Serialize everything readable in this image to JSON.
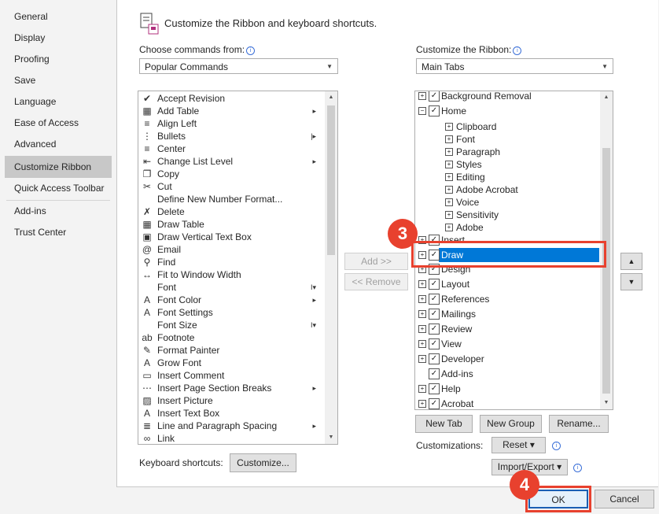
{
  "sidebar": {
    "items": [
      {
        "label": "General"
      },
      {
        "label": "Display"
      },
      {
        "label": "Proofing"
      },
      {
        "label": "Save"
      },
      {
        "label": "Language"
      },
      {
        "label": "Ease of Access"
      },
      {
        "label": "Advanced"
      },
      {
        "label": "Customize Ribbon"
      },
      {
        "label": "Quick Access Toolbar"
      },
      {
        "label": "Add-ins"
      },
      {
        "label": "Trust Center"
      }
    ],
    "active": "Customize Ribbon"
  },
  "header": {
    "title": "Customize the Ribbon and keyboard shortcuts."
  },
  "left": {
    "label": "Choose commands from:",
    "combo_value": "Popular Commands",
    "commands": [
      {
        "label": "Accept Revision",
        "icon": "accept-revision-icon",
        "glyph": "✔"
      },
      {
        "label": "Add Table",
        "icon": "table-icon",
        "glyph": "▦",
        "sub": "▸"
      },
      {
        "label": "Align Left",
        "icon": "align-left-icon",
        "glyph": "≡"
      },
      {
        "label": "Bullets",
        "icon": "bullets-icon",
        "glyph": "⋮",
        "sub": "|▸"
      },
      {
        "label": "Center",
        "icon": "center-icon",
        "glyph": "≡"
      },
      {
        "label": "Change List Level",
        "icon": "list-level-icon",
        "glyph": "⇤",
        "sub": "▸"
      },
      {
        "label": "Copy",
        "icon": "copy-icon",
        "glyph": "❐"
      },
      {
        "label": "Cut",
        "icon": "scissors-icon",
        "glyph": "✂"
      },
      {
        "label": "Define New Number Format...",
        "icon": "",
        "glyph": ""
      },
      {
        "label": "Delete",
        "icon": "delete-icon",
        "glyph": "✗"
      },
      {
        "label": "Draw Table",
        "icon": "draw-table-icon",
        "glyph": "▦"
      },
      {
        "label": "Draw Vertical Text Box",
        "icon": "text-box-icon",
        "glyph": "▣"
      },
      {
        "label": "Email",
        "icon": "email-icon",
        "glyph": "@"
      },
      {
        "label": "Find",
        "icon": "search-icon",
        "glyph": "⚲"
      },
      {
        "label": "Fit to Window Width",
        "icon": "fit-width-icon",
        "glyph": "↔"
      },
      {
        "label": "Font",
        "icon": "",
        "glyph": "",
        "sub": "I▾"
      },
      {
        "label": "Font Color",
        "icon": "font-color-icon",
        "glyph": "A",
        "sub": "▸"
      },
      {
        "label": "Font Settings",
        "icon": "font-settings-icon",
        "glyph": "A"
      },
      {
        "label": "Font Size",
        "icon": "",
        "glyph": "",
        "sub": "I▾"
      },
      {
        "label": "Footnote",
        "icon": "footnote-icon",
        "glyph": "ab"
      },
      {
        "label": "Format Painter",
        "icon": "format-painter-icon",
        "glyph": "✎"
      },
      {
        "label": "Grow Font",
        "icon": "grow-font-icon",
        "glyph": "A"
      },
      {
        "label": "Insert Comment",
        "icon": "comment-icon",
        "glyph": "▭"
      },
      {
        "label": "Insert Page  Section Breaks",
        "icon": "page-break-icon",
        "glyph": "⋯",
        "sub": "▸"
      },
      {
        "label": "Insert Picture",
        "icon": "picture-icon",
        "glyph": "▨"
      },
      {
        "label": "Insert Text Box",
        "icon": "text-box-icon",
        "glyph": "A"
      },
      {
        "label": "Line and Paragraph Spacing",
        "icon": "spacing-icon",
        "glyph": "≣",
        "sub": "▸"
      },
      {
        "label": "Link",
        "icon": "link-icon",
        "glyph": "∞"
      }
    ]
  },
  "middle": {
    "add_label": "Add >>",
    "remove_label": "<< Remove"
  },
  "right": {
    "label": "Customize the Ribbon:",
    "combo_value": "Main Tabs",
    "tree": [
      {
        "label": "Background Removal",
        "level": 0,
        "exp": "+",
        "checked": true
      },
      {
        "label": "Home",
        "level": 0,
        "exp": "−",
        "checked": true
      },
      {
        "label": "Clipboard",
        "level": 1,
        "exp": "+"
      },
      {
        "label": "Font",
        "level": 1,
        "exp": "+"
      },
      {
        "label": "Paragraph",
        "level": 1,
        "exp": "+"
      },
      {
        "label": "Styles",
        "level": 1,
        "exp": "+"
      },
      {
        "label": "Editing",
        "level": 1,
        "exp": "+"
      },
      {
        "label": "Adobe Acrobat",
        "level": 1,
        "exp": "+"
      },
      {
        "label": "Voice",
        "level": 1,
        "exp": "+"
      },
      {
        "label": "Sensitivity",
        "level": 1,
        "exp": "+"
      },
      {
        "label": "Adobe",
        "level": 1,
        "exp": "+"
      },
      {
        "label": "Insert",
        "level": 0,
        "exp": "+",
        "checked": true
      },
      {
        "label": "Draw",
        "level": 0,
        "exp": "+",
        "checked": true,
        "selected": true
      },
      {
        "label": "Design",
        "level": 0,
        "exp": "+",
        "checked": true
      },
      {
        "label": "Layout",
        "level": 0,
        "exp": "+",
        "checked": true
      },
      {
        "label": "References",
        "level": 0,
        "exp": "+",
        "checked": true
      },
      {
        "label": "Mailings",
        "level": 0,
        "exp": "+",
        "checked": true
      },
      {
        "label": "Review",
        "level": 0,
        "exp": "+",
        "checked": true
      },
      {
        "label": "View",
        "level": 0,
        "exp": "+",
        "checked": true
      },
      {
        "label": "Developer",
        "level": 0,
        "exp": "+",
        "checked": true
      },
      {
        "label": "Add-ins",
        "level": 0,
        "exp": "",
        "checked": true
      },
      {
        "label": "Help",
        "level": 0,
        "exp": "+",
        "checked": true
      },
      {
        "label": "Acrobat",
        "level": 0,
        "exp": "+",
        "checked": true
      }
    ],
    "new_tab": "New Tab",
    "new_group": "New Group",
    "rename": "Rename...",
    "customizations_label": "Customizations:",
    "reset": "Reset ▾",
    "import_export": "Import/Export ▾"
  },
  "keyboard": {
    "label": "Keyboard shortcuts:",
    "button": "Customize..."
  },
  "footer": {
    "ok": "OK",
    "cancel": "Cancel"
  },
  "annotations": {
    "step3": "3",
    "step4": "4",
    "color": "#e8412e"
  }
}
